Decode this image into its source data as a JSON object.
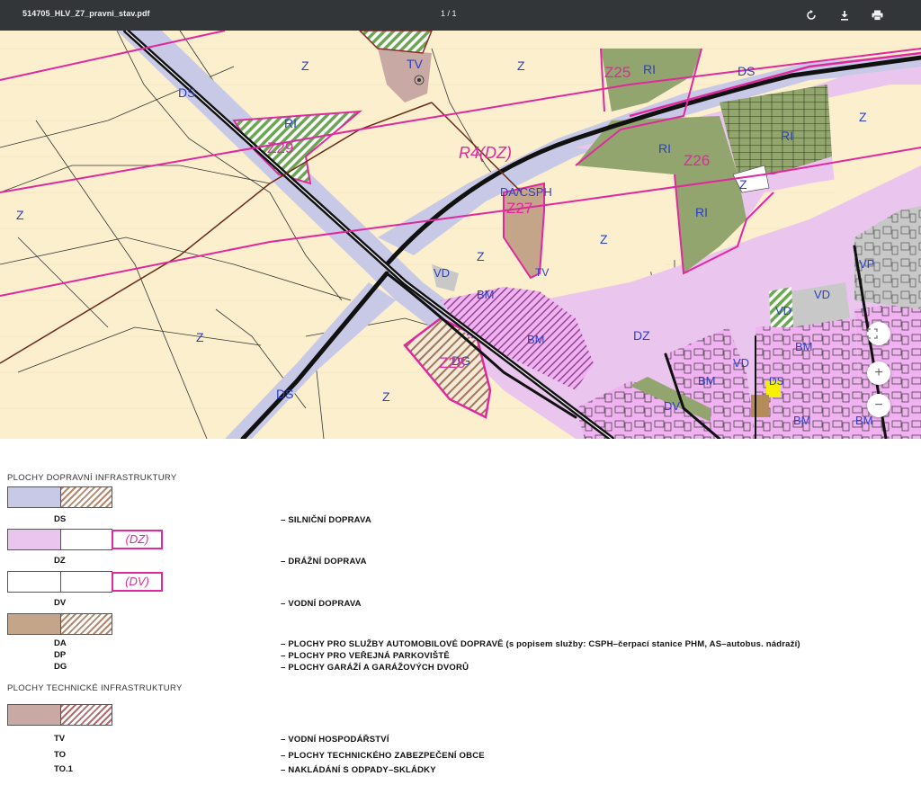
{
  "toolbar": {
    "filename": "514705_HLV_Z7_pravni_stav.pdf",
    "page_indicator": "1 / 1",
    "rotate_icon": "rotate-icon",
    "download_icon": "download-icon",
    "print_icon": "print-icon"
  },
  "map": {
    "labels": {
      "z1": "Z",
      "z2": "Z",
      "z3": "Z",
      "z4": "Z",
      "z5": "Z",
      "z6": "Z",
      "z7": "Z",
      "z8": "Z",
      "z9": "Z",
      "z10": "Z",
      "ds1": "DS",
      "ds2": "DS",
      "ds3": "DS",
      "ds4": "DS",
      "tv1": "TV",
      "tv2": "TV",
      "ri1": "RI",
      "ri2": "RI",
      "ri3": "RI",
      "ri4": "RI",
      "ri5": "RI",
      "z25": "Z25",
      "z26": "Z26",
      "z27": "Z27",
      "z28": "Z28",
      "z29": "Z29",
      "r4dz": "R4(DZ)",
      "dacsph": "DA/CSPH",
      "vd1": "VD",
      "vd2": "VD",
      "vd3": "VD",
      "vd4": "VD",
      "vp": "VP",
      "bm1": "BM",
      "bm2": "BM",
      "bm3": "BM",
      "bm4": "BM",
      "bm5": "BM",
      "bm6": "BM",
      "dz": "DZ",
      "dg": "DG",
      "dv": "DV"
    },
    "zoom_controls": {
      "fit_icon": "fit-page-icon",
      "zoom_in": "+",
      "zoom_out": "−"
    }
  },
  "legend": {
    "section_transport": "PLOCHY DOPRAVNÍ INFRASTRUKTURY",
    "section_technical": "PLOCHY TECHNICKÉ INFRASTRUKTURY",
    "rows": [
      {
        "code": "DS",
        "desc": "– SILNIČNÍ DOPRAVA"
      },
      {
        "code": "DZ",
        "desc": "– DRÁŽNÍ DOPRAVA",
        "tag": "(DZ)"
      },
      {
        "code": "DV",
        "desc": "– VODNÍ DOPRAVA",
        "tag": "(DV)"
      },
      {
        "code": "DA",
        "desc": "– PLOCHY PRO SLUŽBY AUTOMOBILOVÉ DOPRAVĚ (s popisem služby: CSPH–čerpací stanice PHM, AS–autobus. nádraží)"
      },
      {
        "code": "DP",
        "desc": "– PLOCHY PRO VEŘEJNÁ PARKOVIŠTĚ"
      },
      {
        "code": "DG",
        "desc": "– PLOCHY GARÁŽÍ A GARÁŽOVÝCH DVORŮ"
      },
      {
        "code": "TV",
        "desc": "– VODNÍ HOSPODÁŘSTVÍ"
      },
      {
        "code": "TO",
        "desc": "– PLOCHY TECHNICKÉHO ZABEZPEČENÍ OBCE"
      },
      {
        "code": "TO.1",
        "desc": "– NAKLÁDÁNÍ S ODPADY–SKLÁDKY"
      }
    ]
  },
  "colors": {
    "agri": "#fbefcd",
    "road": "#c7c9e7",
    "rail": "#eac6ee",
    "urban": "#f0b2f0",
    "green": "#93a56e",
    "magenta": "#e0289f",
    "label_blue": "#2b3fc9",
    "da_brown": "#c4a58a",
    "tv_rose": "#c9a9a4"
  }
}
